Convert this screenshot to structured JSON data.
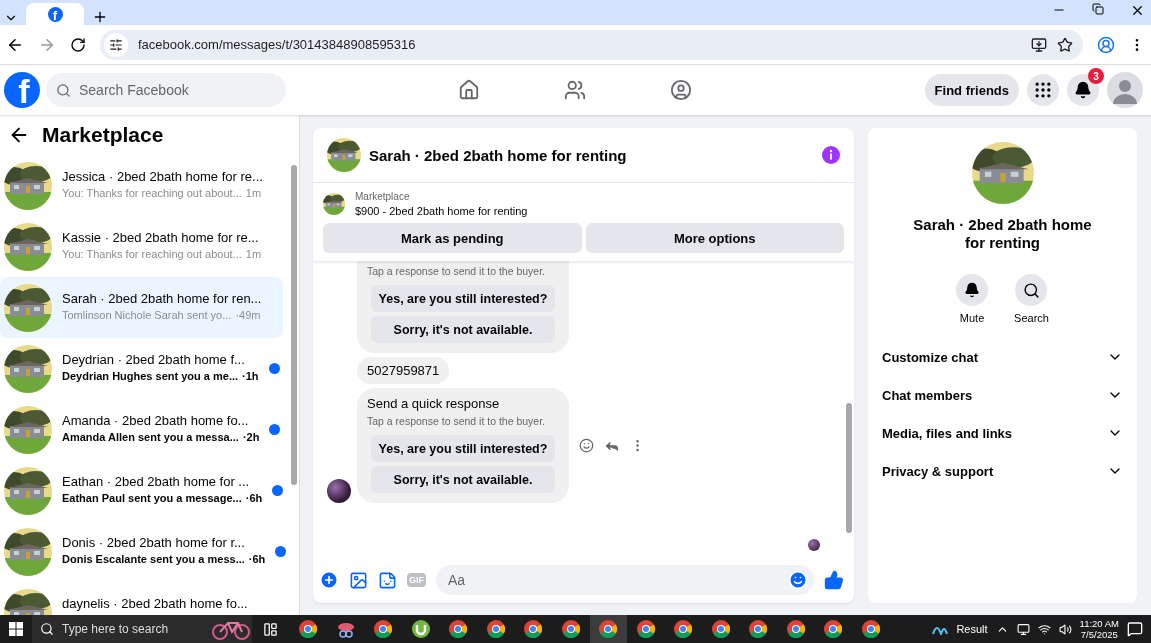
{
  "browser": {
    "tab_logo": "f",
    "address": "facebook.com/messages/t/30143848908595316"
  },
  "header": {
    "logo": "f",
    "search": {
      "placeholder": "Search Facebook"
    },
    "find_friends": "Find friends",
    "notification_count": "3"
  },
  "sidebar": {
    "title": "Marketplace",
    "conversations": [
      {
        "name": "Jessica · 2bed 2bath home for re...",
        "preview": "You: Thanks for reaching out about...",
        "time": "1m",
        "unread": false,
        "selected": false
      },
      {
        "name": "Kassie · 2bed 2bath home for re...",
        "preview": "You: Thanks for reaching out about...",
        "time": "1m",
        "unread": false,
        "selected": false
      },
      {
        "name": "Sarah · 2bed 2bath home for ren...",
        "preview": "Tomlinson Nichole Sarah sent yo...",
        "time": "·49m",
        "unread": false,
        "selected": true
      },
      {
        "name": "Deydrian · 2bed 2bath home f...",
        "preview": "Deydrian Hughes sent you a me...",
        "time": "·1h",
        "unread": true,
        "selected": false
      },
      {
        "name": "Amanda · 2bed 2bath home fo...",
        "preview": "Amanda Allen sent you a messa...",
        "time": "·2h",
        "unread": true,
        "selected": false
      },
      {
        "name": "Eathan · 2bed 2bath home for ...",
        "preview": "Eathan Paul sent you a message...",
        "time": "·6h",
        "unread": true,
        "selected": false
      },
      {
        "name": "Donis · 2bed 2bath home for r...",
        "preview": "Donis Escalante sent you a mess...",
        "time": "·6h",
        "unread": true,
        "selected": false
      },
      {
        "name": "daynelis · 2bed 2bath home fo...",
        "unread": false,
        "selected": false
      }
    ]
  },
  "chat": {
    "title": "Sarah · 2bed 2bath home for renting",
    "listing": {
      "label": "Marketplace",
      "text": "$900 - 2bed 2bath home for renting"
    },
    "actions": [
      "Mark as pending",
      "More options"
    ],
    "messages": [
      {
        "kind": "quick_response",
        "subtitle": "Tap a response to send it to the buyer.",
        "options": [
          "Yes, are you still interested?",
          "Sorry, it's not available."
        ]
      },
      {
        "kind": "text",
        "text": "5027959871"
      },
      {
        "kind": "quick_response",
        "title": "Send a quick response",
        "subtitle": "Tap a response to send it to the buyer.",
        "options": [
          "Yes, are you still interested?",
          "Sorry, it's not available."
        ]
      }
    ],
    "composer": {
      "gif": "GIF",
      "placeholder": "Aa"
    }
  },
  "details": {
    "title": "Sarah · 2bed 2bath home for renting",
    "actions": [
      {
        "kind": "mute",
        "label": "Mute"
      },
      {
        "kind": "search",
        "label": "Search"
      }
    ],
    "sections": [
      "Customize chat",
      "Chat members",
      "Media, files and links",
      "Privacy & support"
    ]
  },
  "taskbar": {
    "search_placeholder": "Type here to search",
    "apps": [
      {
        "kind": "chrome",
        "selected": false
      },
      {
        "kind": "tool",
        "selected": false
      },
      {
        "kind": "chrome",
        "selected": false
      },
      {
        "kind": "torrent",
        "selected": false
      },
      {
        "kind": "chrome",
        "selected": false
      },
      {
        "kind": "chrome",
        "selected": false
      },
      {
        "kind": "chrome",
        "selected": false
      },
      {
        "kind": "chrome",
        "selected": false
      },
      {
        "kind": "chrome",
        "selected": true
      },
      {
        "kind": "chrome",
        "selected": false
      },
      {
        "kind": "chrome",
        "selected": false
      },
      {
        "kind": "chrome",
        "selected": false
      },
      {
        "kind": "chrome",
        "selected": false
      },
      {
        "kind": "chrome",
        "selected": false
      },
      {
        "kind": "chrome",
        "selected": false
      },
      {
        "kind": "chrome",
        "selected": false
      }
    ],
    "weather": "Result",
    "time": "11:20 AM",
    "date": "7/5/2025"
  }
}
